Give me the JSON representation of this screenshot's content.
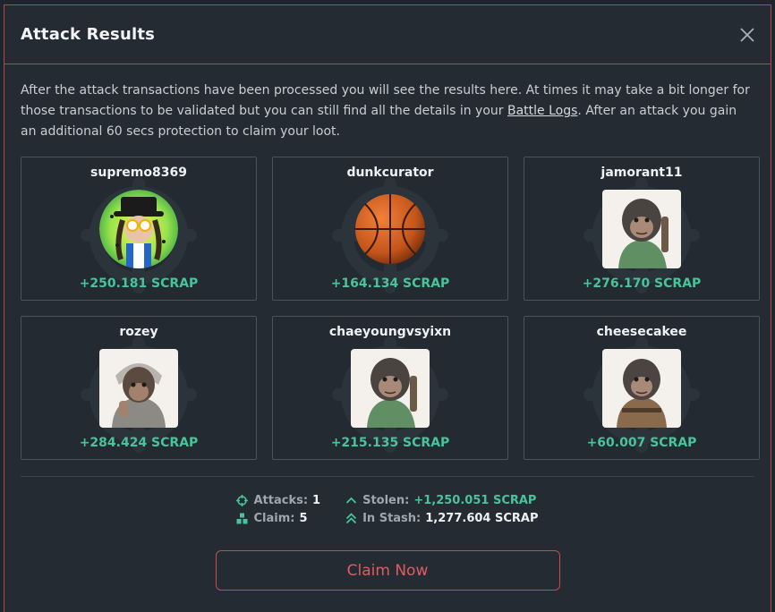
{
  "modal": {
    "title": "Attack Results",
    "close_icon": "close-icon",
    "description_part1": "After the attack transactions have been processed you will see the results here. At times it may take a bit longer for those transactions to be validated but you can still find all the details in your ",
    "battle_logs_link": "Battle Logs",
    "description_part2": ". After an attack you gain an additional 60 secs protection to claim your loot."
  },
  "results": [
    {
      "name": "supremo8369",
      "gain": "+250.181 SCRAP",
      "avatar": "cartoon-character-avatar"
    },
    {
      "name": "dunkcurator",
      "gain": "+164.134 SCRAP",
      "avatar": "basketball-avatar"
    },
    {
      "name": "jamorant11",
      "gain": "+276.170 SCRAP",
      "avatar": "ape-green-jacket-avatar"
    },
    {
      "name": "rozey",
      "gain": "+284.424 SCRAP",
      "avatar": "ape-grey-hoodie-avatar"
    },
    {
      "name": "chaeyoungvsyixn",
      "gain": "+215.135 SCRAP",
      "avatar": "ape-green-jacket-avatar"
    },
    {
      "name": "cheesecakee",
      "gain": "+60.007 SCRAP",
      "avatar": "ape-brown-coat-avatar"
    }
  ],
  "stats": {
    "attacks_label": "Attacks:",
    "attacks_value": "1",
    "claim_label": "Claim:",
    "claim_value": "5",
    "stolen_label": "Stolen:",
    "stolen_value": "+1,250.051 SCRAP",
    "stash_label": "In Stash:",
    "stash_value": "1,277.604 SCRAP"
  },
  "claim_button": "Claim Now",
  "colors": {
    "accent_red": "#c94a4f",
    "gain_green": "#47c49a",
    "background": "#242b33"
  }
}
